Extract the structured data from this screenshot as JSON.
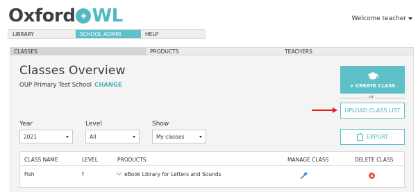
{
  "brand": {
    "text_oxford": "Oxford",
    "text_owl_1": "",
    "text_owl_2": "WL",
    "accent": "#5ec0c8"
  },
  "header": {
    "welcome": "Welcome teacher"
  },
  "top_tabs": [
    {
      "label": "LIBRARY"
    },
    {
      "label": "SCHOOL ADMIN",
      "active": true
    },
    {
      "label": "HELP"
    }
  ],
  "sub_tabs": [
    {
      "label": "CLASSES",
      "active": true
    },
    {
      "label": "PRODUCTS"
    },
    {
      "label": "TEACHERS"
    }
  ],
  "page": {
    "title": "Classes Overview",
    "school_name": "OUP Primary Test School",
    "change_link": "CHANGE"
  },
  "actions": {
    "create_class": "CREATE CLASS",
    "or": "or",
    "upload_class_list": "UPLOAD CLASS LIST",
    "export": "EXPORT"
  },
  "filters": {
    "year": {
      "label": "Year",
      "value": "2021"
    },
    "level": {
      "label": "Level",
      "value": "All"
    },
    "show": {
      "label": "Show",
      "value": "My classes"
    }
  },
  "table": {
    "headers": [
      "CLASS NAME",
      "LEVEL",
      "PRODUCTS",
      "MANAGE CLASS",
      "DELETE CLASS"
    ],
    "rows": [
      {
        "class_name": "Fish",
        "level": "f",
        "product": "eBook Library for Letters and Sounds"
      }
    ]
  }
}
